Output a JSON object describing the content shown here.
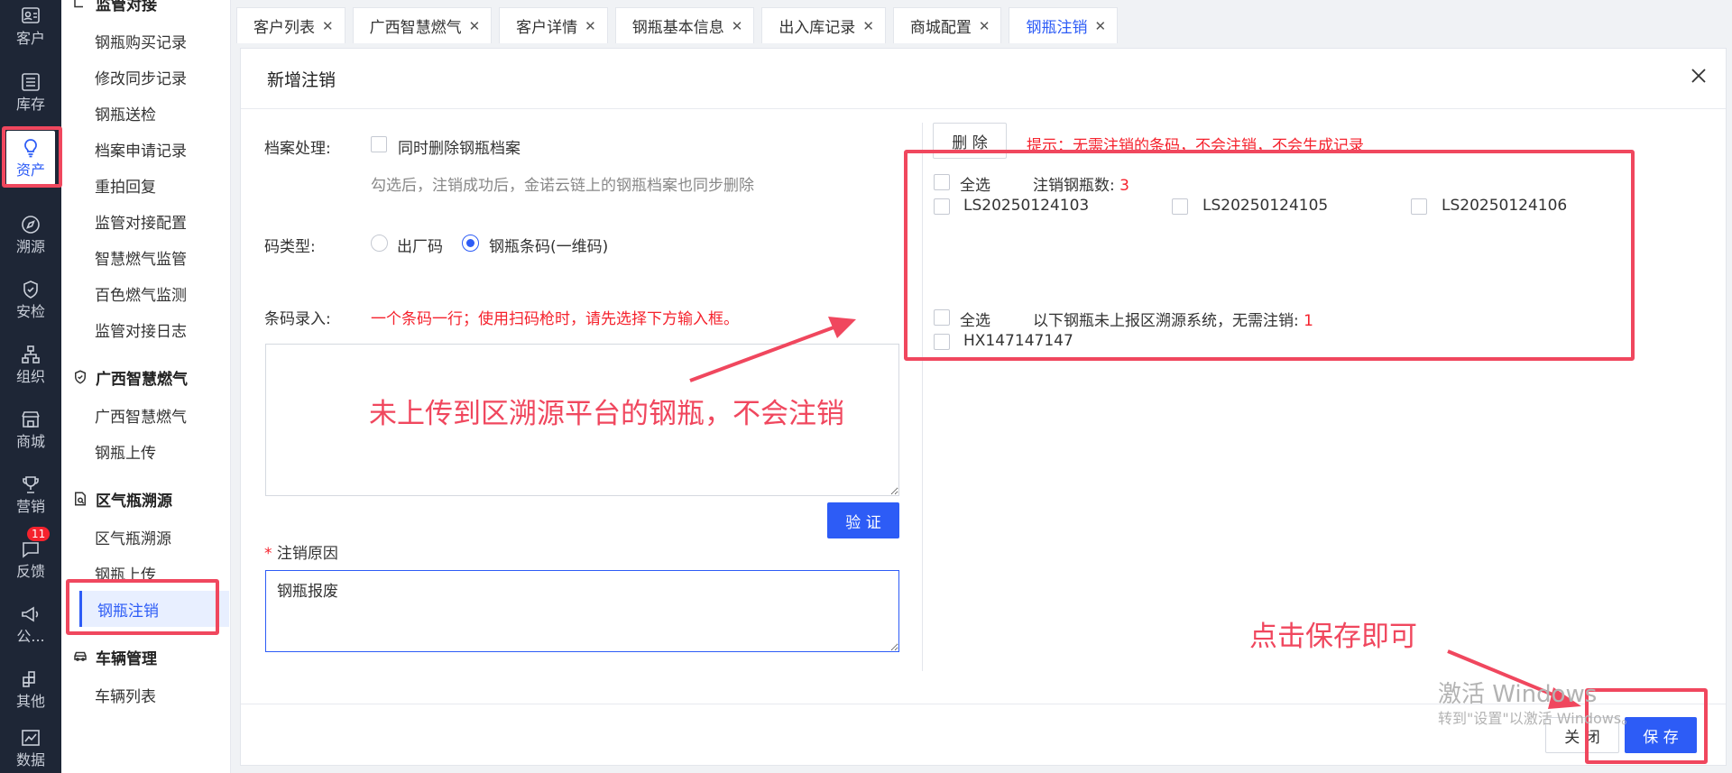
{
  "rail": {
    "items": [
      {
        "label": "客户",
        "icon": "customer-card-icon"
      },
      {
        "label": "库存",
        "icon": "inventory-list-icon"
      },
      {
        "label": "资产",
        "icon": "lightbulb-icon"
      },
      {
        "label": "溯源",
        "icon": "compass-icon"
      },
      {
        "label": "安检",
        "icon": "shield-check-icon"
      },
      {
        "label": "组织",
        "icon": "org-chart-icon"
      },
      {
        "label": "商城",
        "icon": "store-icon"
      },
      {
        "label": "营销",
        "icon": "trophy-icon"
      },
      {
        "label": "反馈",
        "icon": "feedback-icon",
        "badge": "11"
      },
      {
        "label": "公...",
        "icon": "megaphone-icon"
      },
      {
        "label": "其他",
        "icon": "apps-icon"
      },
      {
        "label": "数据",
        "icon": "chart-icon"
      }
    ]
  },
  "submenu": {
    "group1_title": "监管对接",
    "group1_items": [
      "钢瓶购买记录",
      "修改同步记录",
      "钢瓶送检",
      "档案申请记录",
      "重拍回复",
      "监管对接配置",
      "智慧燃气监管",
      "百色燃气监测",
      "监管对接日志"
    ],
    "group2_title": "广西智慧燃气",
    "group2_items": [
      "广西智慧燃气",
      "钢瓶上传"
    ],
    "group3_title": "区气瓶溯源",
    "group3_items": [
      "区气瓶溯源",
      "钢瓶上传",
      "钢瓶注销"
    ],
    "group4_title": "车辆管理",
    "group4_items": [
      "车辆列表"
    ]
  },
  "tabs": [
    {
      "label": "客户列表"
    },
    {
      "label": "广西智慧燃气"
    },
    {
      "label": "客户详情"
    },
    {
      "label": "钢瓶基本信息"
    },
    {
      "label": "出入库记录"
    },
    {
      "label": "商城配置"
    },
    {
      "label": "钢瓶注销"
    }
  ],
  "dialog": {
    "title": "新增注销",
    "archive_label": "档案处理:",
    "archive_checkbox": "同时删除钢瓶档案",
    "archive_hint": "勾选后，注销成功后，金诺云链上的钢瓶档案也同步删除",
    "code_type_label": "码类型:",
    "code_type_options": [
      "出厂码",
      "钢瓶条码(一维码)"
    ],
    "barcode_label": "条码录入:",
    "barcode_hint": "一个条码一行；使用扫码枪时，请先选择下方输入框。",
    "verify_button": "验 证",
    "reason_required": "*",
    "reason_label": "注销原因",
    "reason_value": "钢瓶报废",
    "delete_button": "删 除",
    "tip": "提示：无需注销的条码，不会注销，不会生成记录",
    "select_all": "全选",
    "cancel_count_label": "注销钢瓶数:",
    "cancel_count": "3",
    "codes": [
      "LS20250124103",
      "LS20250124105",
      "LS20250124106"
    ],
    "not_reported_label": "以下钢瓶未上报区溯源系统，无需注销:",
    "not_reported_count": "1",
    "not_reported_codes": [
      "HX147147147"
    ],
    "close_button": "关 闭",
    "save_button": "保 存"
  },
  "annotations": {
    "note1": "未上传到区溯源平台的钢瓶，不会注销",
    "note2": "点击保存即可"
  },
  "watermark": {
    "line1": "激活 Windows",
    "line2": "转到\"设置\"以激活 Windows。"
  },
  "colors": {
    "accent": "#2d5cf6",
    "annotation": "#f0475e",
    "rail_bg": "#1e2636"
  }
}
